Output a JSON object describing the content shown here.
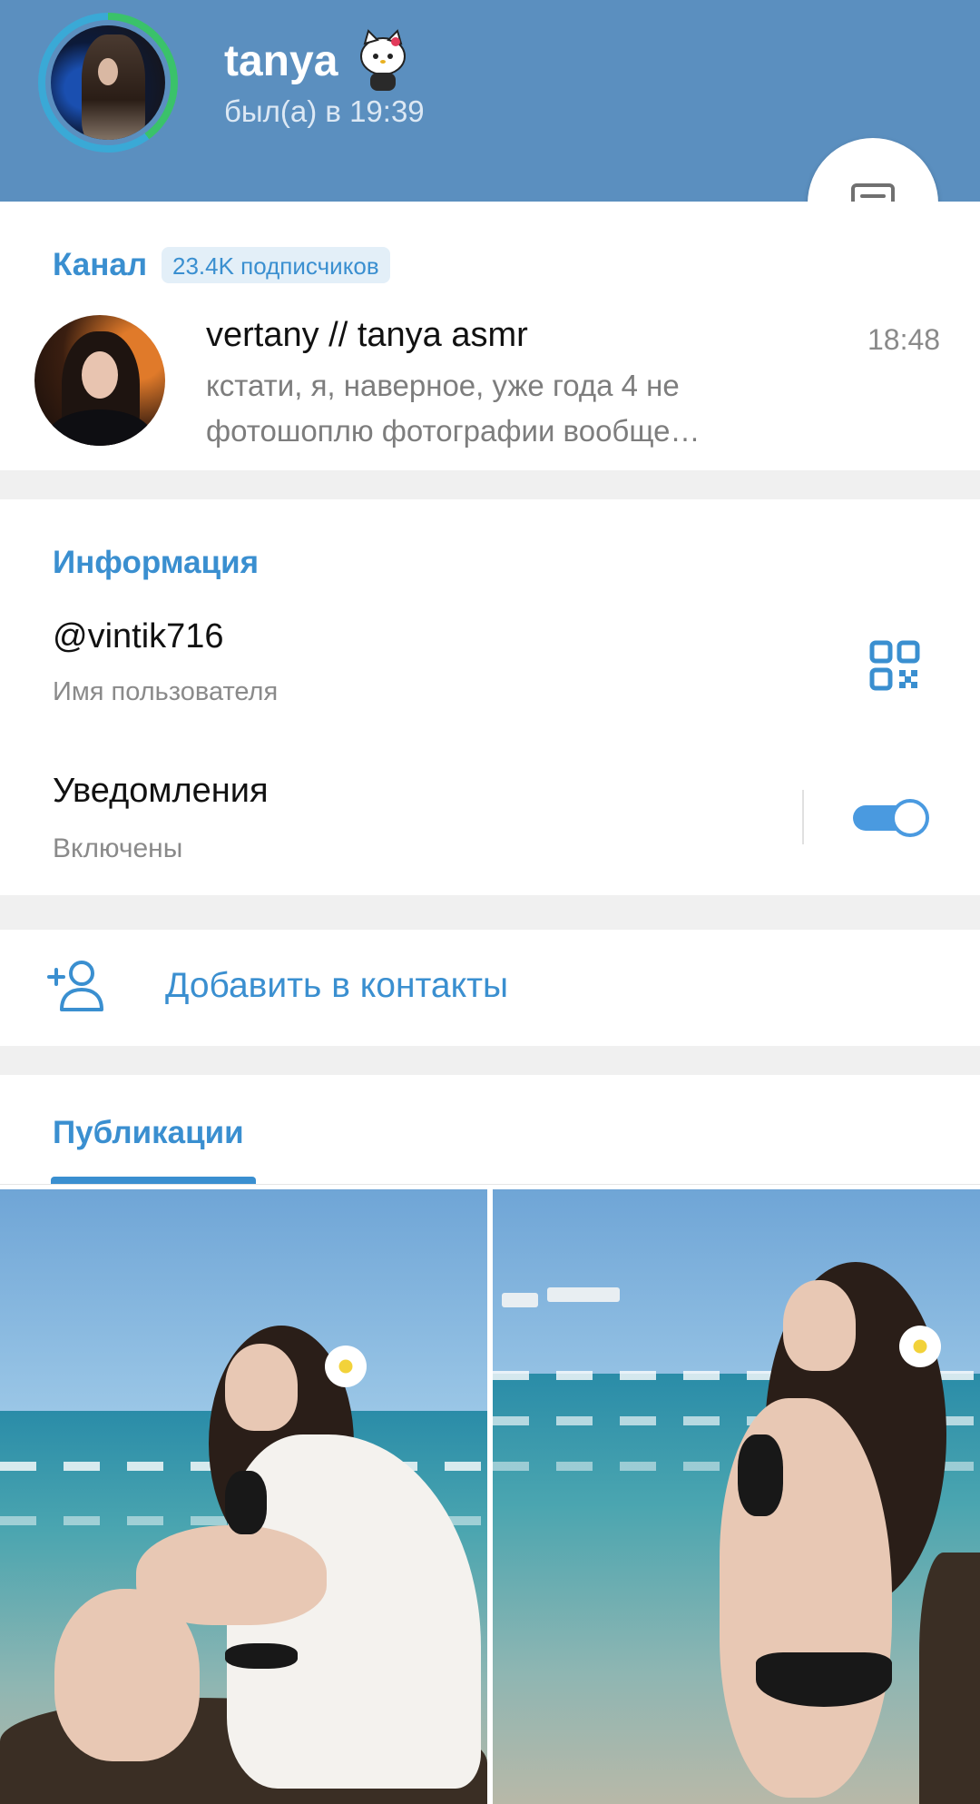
{
  "header": {
    "name": "tanya",
    "last_seen": "был(а) в 19:39",
    "avatar_icon": "profile-photo",
    "status_emoji": "hello-kitty-icon",
    "fab_icon": "message-icon"
  },
  "channel": {
    "label": "Канал",
    "subscribers": "23.4K подписчиков",
    "title": "vertany // tanya asmr",
    "time": "18:48",
    "preview": "кстати, я, наверное, уже года 4 не фотошоплю фотографии вообще…"
  },
  "info": {
    "section_title": "Информация",
    "username": "@vintik716",
    "username_label": "Имя пользователя",
    "notifications_title": "Уведомления",
    "notifications_state": "Включены",
    "notifications_on": true
  },
  "actions": {
    "add_contact": "Добавить в контакты",
    "add_contact_icon": "add-user-icon"
  },
  "publications": {
    "tab_label": "Публикации",
    "photos": [
      "photo-1",
      "photo-2"
    ]
  },
  "colors": {
    "header_bg": "#5b8fbf",
    "accent": "#3a8fd0",
    "toggle": "#4a9ae0"
  }
}
